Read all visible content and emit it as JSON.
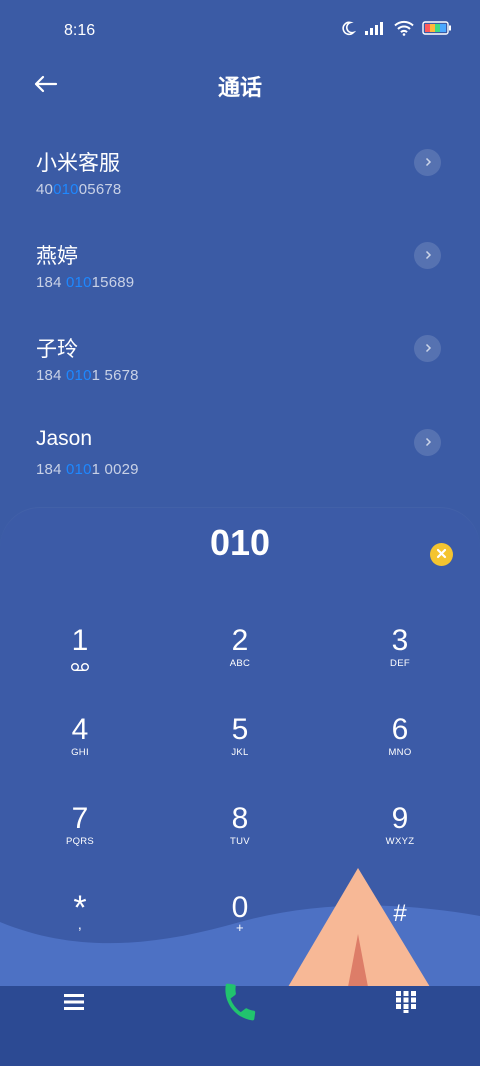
{
  "status_bar": {
    "time": "8:16"
  },
  "header": {
    "title": "通话"
  },
  "contacts": [
    {
      "name": "小米客服",
      "number_pre": "40",
      "number_match": "010",
      "number_post": "05678"
    },
    {
      "name": "燕婷",
      "number_pre": "184 ",
      "number_match": "010",
      "number_post": "15689"
    },
    {
      "name": "子玲",
      "number_pre": "184 ",
      "number_match": "010",
      "number_post": "1 5678"
    },
    {
      "name": "Jason",
      "number_pre": "184 ",
      "number_match": "010",
      "number_post": "1 0029"
    }
  ],
  "dialpad": {
    "input": "010",
    "keys": [
      {
        "digit": "1",
        "letters": ""
      },
      {
        "digit": "2",
        "letters": "ABC"
      },
      {
        "digit": "3",
        "letters": "DEF"
      },
      {
        "digit": "4",
        "letters": "GHI"
      },
      {
        "digit": "5",
        "letters": "JKL"
      },
      {
        "digit": "6",
        "letters": "MNO"
      },
      {
        "digit": "7",
        "letters": "PQRS"
      },
      {
        "digit": "8",
        "letters": "TUV"
      },
      {
        "digit": "9",
        "letters": "WXYZ"
      },
      {
        "digit": "*",
        "letters": ","
      },
      {
        "digit": "0",
        "letters": "+"
      },
      {
        "digit": "#",
        "letters": ""
      }
    ]
  },
  "icons": {
    "back": "arrow-left-icon",
    "chevron": "chevron-right-icon",
    "clear": "clear-x-icon",
    "voicemail": "voicemail-icon",
    "menu": "menu-icon",
    "call": "phone-icon",
    "dialpad": "dialpad-grid-icon"
  },
  "colors": {
    "background": "#3b5ba5",
    "highlight": "#1e88ff",
    "clear_button": "#f4c430",
    "call_icon": "#21c36e",
    "tent": "#f7b896",
    "hill": "#4d71c4"
  }
}
